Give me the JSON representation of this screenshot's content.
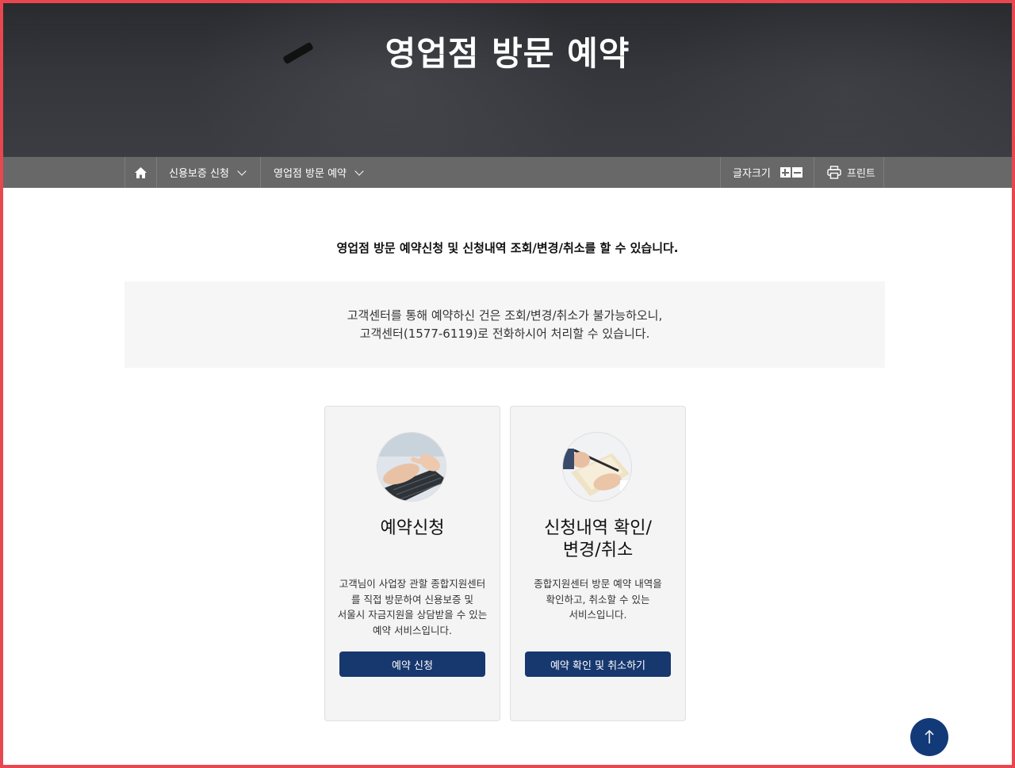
{
  "hero": {
    "title": "영업점 방문 예약"
  },
  "breadcrumb": {
    "items": [
      {
        "label": "신용보증 신청"
      },
      {
        "label": "영업점 방문 예약"
      }
    ]
  },
  "toolbar": {
    "font_size_label": "글자크기",
    "print_label": "프린트"
  },
  "intro": "영업점 방문 예약신청 및 신청내역 조회/변경/취소를 할 수 있습니다.",
  "notice": {
    "line1": "고객센터를 통해 예약하신 건은 조회/변경/취소가 불가능하오니,",
    "line2": "고객센터(1577-6119)로 전화하시어 처리할 수 있습니다."
  },
  "cards": [
    {
      "title": "예약신청",
      "title_line2": "",
      "desc": [
        "고객님이 사업장 관할 종합지원센터",
        "를 직접 방문하여 신용보증 및",
        "서울시 자금지원을 상담받을 수 있는",
        "예약 서비스입니다."
      ],
      "button": "예약 신청"
    },
    {
      "title": "신청내역 확인/",
      "title_line2": "변경/취소",
      "desc": [
        "종합지원센터 방문 예약 내역을",
        "확인하고, 취소할 수 있는",
        "서비스입니다.",
        ""
      ],
      "button": "예약 확인 및 취소하기"
    }
  ],
  "colors": {
    "accent": "#17386f",
    "nav_bg": "#686868",
    "frame": "#e9474f"
  }
}
